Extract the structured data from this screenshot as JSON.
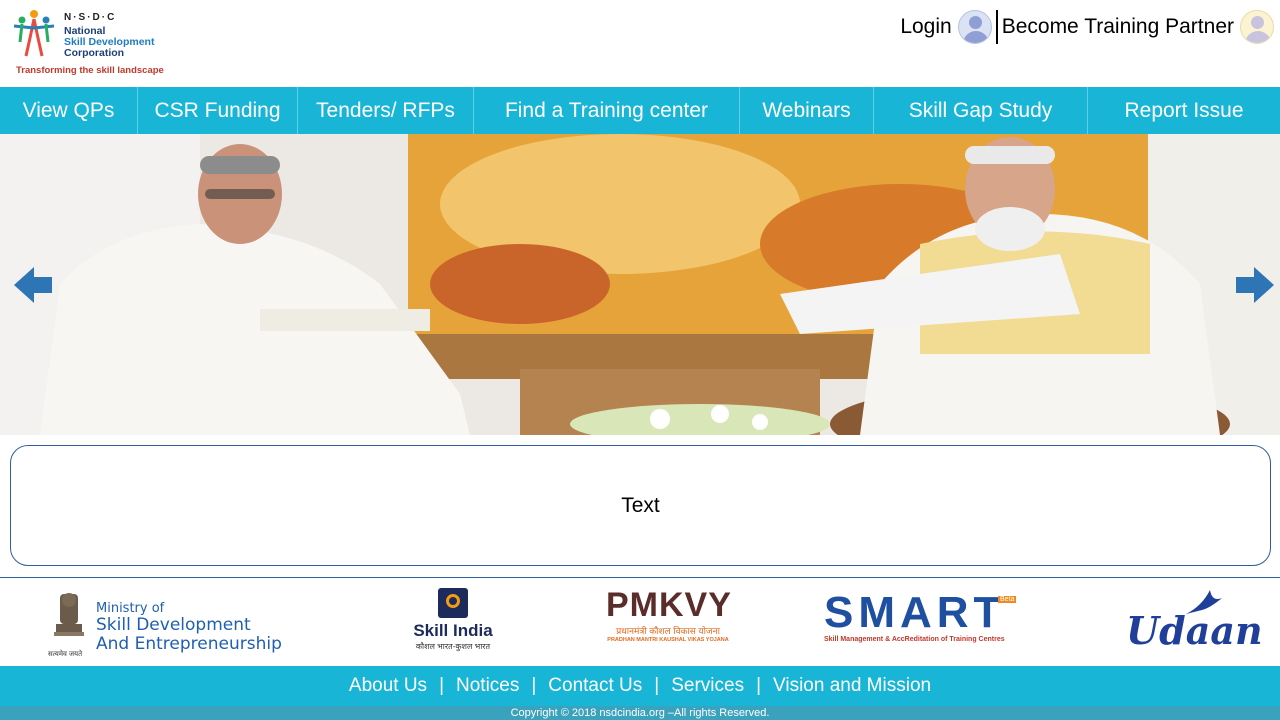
{
  "header": {
    "logo": {
      "acronym": "N·S·D·C",
      "org_line1": "National",
      "org_line2": "Skill Development",
      "org_line3": "Corporation",
      "tagline": "Transforming the skill landscape"
    },
    "login_label": "Login",
    "partner_label": "Become Training Partner",
    "icons": [
      "user-avatar-icon",
      "user-avatar-icon"
    ]
  },
  "nav": {
    "items": [
      {
        "label": "View QPs"
      },
      {
        "label": "CSR Funding"
      },
      {
        "label": "Tenders/ RFPs"
      },
      {
        "label": "Find a Training center"
      },
      {
        "label": "Webinars"
      },
      {
        "label": "Skill Gap Study"
      },
      {
        "label": "Report Issue"
      }
    ]
  },
  "banner": {
    "prev_icon": "arrow-left-icon",
    "next_icon": "arrow-right-icon"
  },
  "content": {
    "text": "Text"
  },
  "partners": {
    "msde": {
      "line1": "Ministry of",
      "line2": "Skill Development",
      "line3": "And Entrepreneurship",
      "motto": "सत्यमेव जयते"
    },
    "skill_india": {
      "name": "Skill India",
      "tagline": "कौशल भारत-कुशल भारत"
    },
    "pmkvy": {
      "name": "PMKVY",
      "hindi": "प्रधानमंत्री कौशल विकास योजना",
      "english": "PRADHAN MANTRI KAUSHAL VIKAS YOJANA"
    },
    "smart": {
      "name": "SMART",
      "beta": "Beta",
      "sub": "Skill Management & AccReditation of Training Centres"
    },
    "udaan": {
      "name": "Udaan"
    }
  },
  "footer": {
    "links": [
      {
        "label": "About Us"
      },
      {
        "label": "Notices"
      },
      {
        "label": "Contact Us"
      },
      {
        "label": "Services"
      },
      {
        "label": "Vision and Mission"
      }
    ],
    "separator": "|",
    "copyright": "Copyright © 2018 nsdcindia.org –All rights Reserved."
  },
  "colors": {
    "nav_bg": "#19b5d6",
    "panel_border": "#2f5e9e",
    "arrow": "#2e75b6"
  }
}
